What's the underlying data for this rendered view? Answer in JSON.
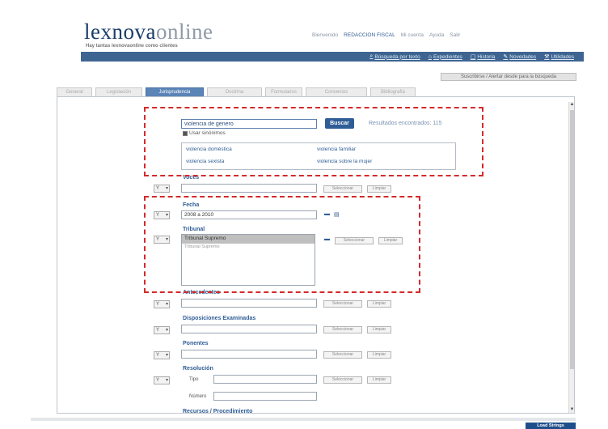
{
  "header": {
    "logo_main": "lexnova",
    "logo_sub": "online",
    "tagline": "Hay tantas lexnovaonline como clientes",
    "user_greeting": "Bienvenido",
    "organization": "REDACCION FISCAL",
    "account_link": "Mi cuenta",
    "help_link": "Ayuda",
    "exit_link": "Salir"
  },
  "navbar": [
    {
      "icon": "magnifier-icon",
      "label": "Búsqueda por texto"
    },
    {
      "icon": "house-icon",
      "label": "Expedientes"
    },
    {
      "icon": "document-icon",
      "label": "Historia"
    },
    {
      "icon": "news-icon",
      "label": "Novedades"
    },
    {
      "icon": "wrench-icon",
      "label": "Utilidades"
    }
  ],
  "subscribe_button": "Suscribirse / Alertar desde para la búsqueda",
  "tabs": [
    "General",
    "Legislación",
    "Jurisprudencia",
    "Doctrina",
    "Formularios",
    "Convenios",
    "Bibliografía"
  ],
  "search": {
    "value": "violencia de genero",
    "button": "Buscar",
    "results": "Resultados encontrados: 115",
    "synonyms_label": "Usar sinónimos",
    "synonyms": [
      "violencia doméstica",
      "violencia familiar",
      "violencia sexista",
      "violencia sobre la mujer"
    ]
  },
  "filters": {
    "operator": "Y",
    "voces": {
      "label": "Voces",
      "value": "",
      "btn1": "Seleccionar",
      "btn2": "Limpiar"
    },
    "fecha": {
      "label": "Fecha",
      "value": "2008 a 2010"
    },
    "tribunal": {
      "label": "Tribunal",
      "selected": "Tribunal Supremo",
      "option": "Tribunal Supremo",
      "btn1": "Seleccionar",
      "btn2": "Limpiar"
    },
    "antecedentes": {
      "label": "Antecedentes",
      "btn1": "Seleccionar",
      "btn2": "Limpiar"
    },
    "disposiciones": {
      "label": "Disposiciones Examinadas",
      "btn1": "Seleccionar",
      "btn2": "Limpiar"
    },
    "ponentes": {
      "label": "Ponentes",
      "btn1": "Seleccionar",
      "btn2": "Limpiar"
    },
    "resolucion": {
      "label": "Resolución",
      "tipo_label": "Tipo",
      "numero_label": "Número",
      "btn1": "Seleccionar",
      "btn2": "Limpiar"
    },
    "recursos": {
      "label": "Recursos / Procedimiento"
    }
  },
  "bottom_button": "Load Strings",
  "colors": {
    "accent": "#2f5d96",
    "navbar": "#3e6592",
    "highlight": "#d42a2a"
  }
}
